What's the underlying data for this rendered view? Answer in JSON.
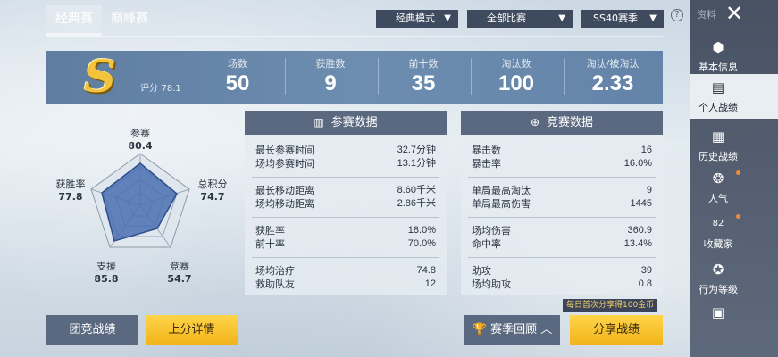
{
  "tabs": [
    {
      "label": "经典赛",
      "active": true
    },
    {
      "label": "巅峰赛",
      "active": false
    }
  ],
  "filters": {
    "mode": "经典模式",
    "match": "全部比赛",
    "season": "SS40赛季"
  },
  "banner": {
    "grade": "S",
    "score_label": "评分",
    "score_value": "78.1",
    "stats": [
      {
        "label": "场数",
        "value": "50"
      },
      {
        "label": "获胜数",
        "value": "9"
      },
      {
        "label": "前十数",
        "value": "35"
      },
      {
        "label": "淘汰数",
        "value": "100"
      },
      {
        "label": "淘汰/被淘汰",
        "value": "2.33"
      }
    ]
  },
  "radar": {
    "axes": [
      {
        "label": "参赛",
        "value": "80.4"
      },
      {
        "label": "总积分",
        "value": "74.7"
      },
      {
        "label": "竞赛",
        "value": "54.7"
      },
      {
        "label": "支援",
        "value": "85.8"
      },
      {
        "label": "获胜率",
        "value": "77.8"
      }
    ]
  },
  "participation_panel": {
    "title": "参赛数据",
    "groups": [
      [
        {
          "k": "最长参赛时间",
          "v": "32.7分钟"
        },
        {
          "k": "场均参赛时间",
          "v": "13.1分钟"
        }
      ],
      [
        {
          "k": "最长移动距离",
          "v": "8.60千米"
        },
        {
          "k": "场均移动距离",
          "v": "2.86千米"
        }
      ],
      [
        {
          "k": "获胜率",
          "v": "18.0%"
        },
        {
          "k": "前十率",
          "v": "70.0%"
        }
      ],
      [
        {
          "k": "场均治疗",
          "v": "74.8"
        },
        {
          "k": "救助队友",
          "v": "12"
        }
      ]
    ]
  },
  "competition_panel": {
    "title": "竞赛数据",
    "groups": [
      [
        {
          "k": "暴击数",
          "v": "16"
        },
        {
          "k": "暴击率",
          "v": "16.0%"
        }
      ],
      [
        {
          "k": "单局最高淘汰",
          "v": "9"
        },
        {
          "k": "单局最高伤害",
          "v": "1445"
        }
      ],
      [
        {
          "k": "场均伤害",
          "v": "360.9"
        },
        {
          "k": "命中率",
          "v": "13.4%"
        }
      ],
      [
        {
          "k": "助攻",
          "v": "39"
        },
        {
          "k": "场均助攻",
          "v": "0.8"
        }
      ]
    ]
  },
  "buttons": {
    "team": "团竞战绩",
    "rank_detail": "上分详情",
    "season_review": "赛季回顾",
    "share": "分享战绩",
    "share_promo": "每日首次分享得100金币"
  },
  "sidebar": {
    "top_text": "资料",
    "items": [
      {
        "label": "基本信息",
        "active": false,
        "dot": false
      },
      {
        "label": "个人战绩",
        "active": true,
        "dot": false
      },
      {
        "label": "历史战绩",
        "active": false,
        "dot": false
      },
      {
        "label": "人气",
        "active": false,
        "dot": true
      },
      {
        "label": "收藏家",
        "active": false,
        "dot": true
      },
      {
        "label": "行为等级",
        "active": false,
        "dot": false
      }
    ],
    "collector_badge": "82"
  },
  "colors": {
    "gold": "#f3c33c",
    "panel_header": "#5a6880",
    "radar_fill": "#4a6fb0",
    "accent_button": "#ffd54a"
  }
}
